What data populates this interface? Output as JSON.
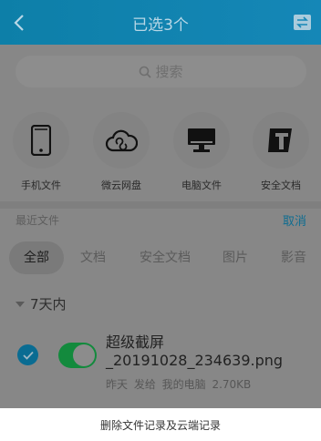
{
  "header": {
    "title": "已选3个"
  },
  "search": {
    "placeholder": "搜索"
  },
  "categories": [
    {
      "label": "手机文件",
      "icon": "phone-icon"
    },
    {
      "label": "微云网盘",
      "icon": "cloud-icon"
    },
    {
      "label": "电脑文件",
      "icon": "monitor-icon"
    },
    {
      "label": "安全文档",
      "icon": "secure-doc-icon"
    }
  ],
  "recent": {
    "label": "最近文件",
    "cancel_label": "取消"
  },
  "tabs": [
    {
      "label": "全部",
      "active": true
    },
    {
      "label": "文档"
    },
    {
      "label": "安全文档"
    },
    {
      "label": "图片"
    },
    {
      "label": "影音"
    }
  ],
  "group": {
    "label": "7天内"
  },
  "file": {
    "name": "超级截屏_20191028_234639.png",
    "meta": "昨天 发给 我的电脑 2.70KB",
    "selected": true
  },
  "bottom": {
    "action_label": "删除文件记录及云端记录"
  },
  "colors": {
    "header": "#1587b7",
    "accent": "#0f6d91",
    "thumb": "#138a3d"
  }
}
